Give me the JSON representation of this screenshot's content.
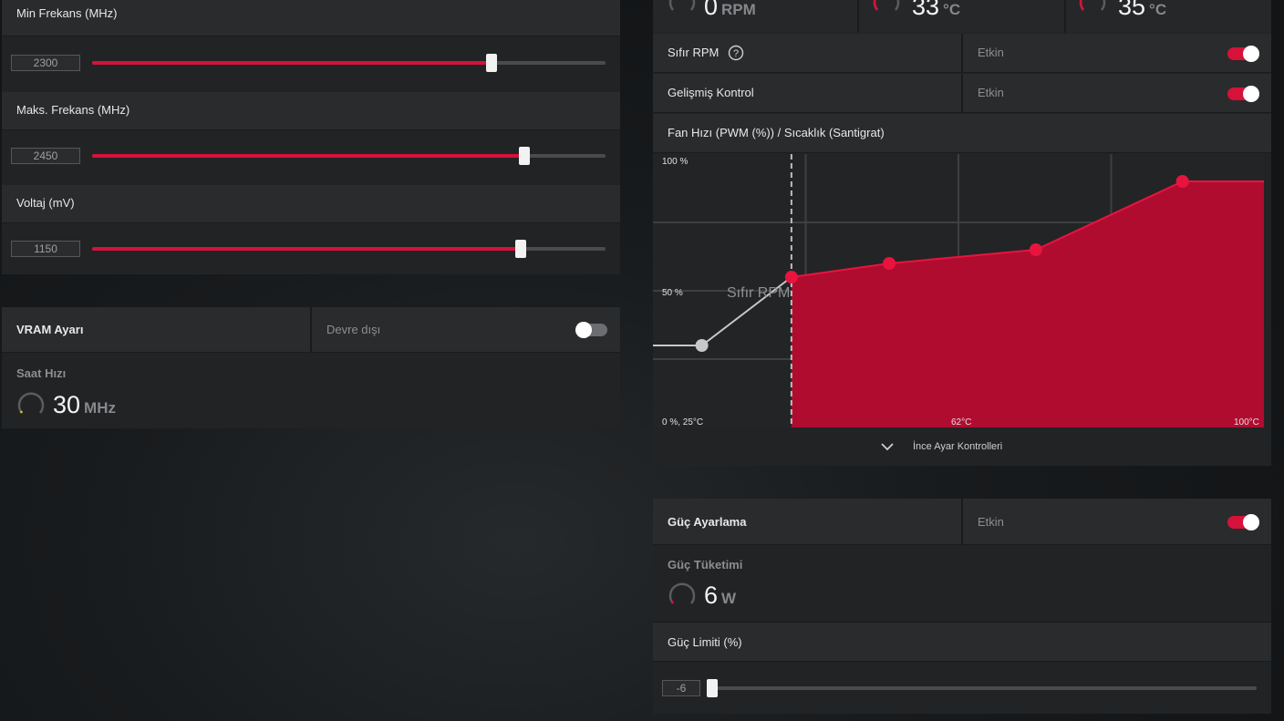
{
  "left_panel": {
    "min_freq": {
      "label": "Min Frekans (MHz)",
      "value": "2300",
      "fraction": 0.778
    },
    "max_freq": {
      "label": "Maks. Frekans (MHz)",
      "value": "2450",
      "fraction": 0.842
    },
    "voltage": {
      "label": "Voltaj (mV)",
      "value": "1150",
      "fraction": 0.835
    }
  },
  "vram": {
    "title": "VRAM Ayarı",
    "status": "Devre dışı",
    "toggle_on": false,
    "clock_label": "Saat Hızı",
    "clock_value": "30",
    "clock_unit": "MHz"
  },
  "fan_top": {
    "rpm_value": "0",
    "rpm_unit": "RPM",
    "temp1_value": "33",
    "temp1_unit": "°C",
    "temp2_value": "35",
    "temp2_unit": "°C"
  },
  "zero_rpm": {
    "label": "Sıfır RPM",
    "status": "Etkin",
    "toggle_on": true
  },
  "advanced": {
    "label": "Gelişmiş Kontrol",
    "status": "Etkin",
    "toggle_on": true
  },
  "fan_curve": {
    "title": "Fan Hızı (PWM (%)) / Sıcaklık (Santigrat)",
    "label_100": "100 %",
    "label_50": "50 %",
    "label_origin": "0 %, 25°C",
    "label_62": "62°C",
    "label_100c": "100°C",
    "zero_rpm_label": "Sıfır RPM",
    "fine_tune": "İnce Ayar Kontrolleri"
  },
  "chart_data": {
    "type": "area",
    "x": [
      31,
      42,
      54,
      72,
      90
    ],
    "series": [
      {
        "values": [
          30,
          55,
          60,
          65,
          90
        ]
      }
    ],
    "xlim": [
      25,
      100
    ],
    "ylim": [
      0,
      100
    ],
    "zero_rpm_threshold_c": 42,
    "extend_to_x": 100
  },
  "power": {
    "title": "Güç Ayarlama",
    "status": "Etkin",
    "toggle_on": true,
    "consumption_label": "Güç Tüketimi",
    "consumption_value": "6",
    "consumption_unit": "W",
    "limit_label": "Güç Limiti (%)",
    "limit_value": "-6",
    "limit_fraction": 0.0
  },
  "colors": {
    "accent": "#d6123a",
    "panel": "#222325",
    "row": "#2a2b2d"
  }
}
